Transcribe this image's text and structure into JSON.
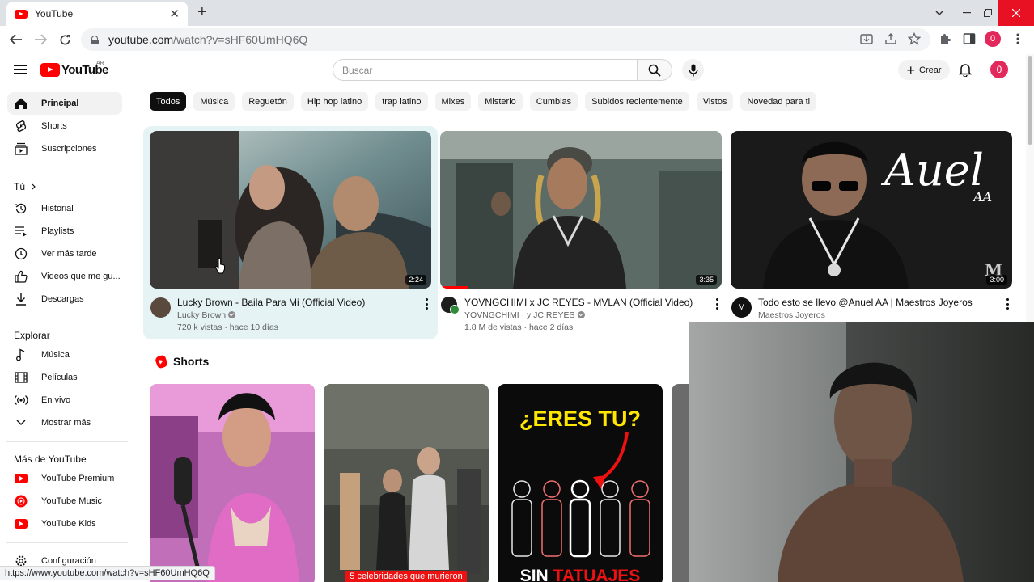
{
  "browser": {
    "tab_title": "YouTube",
    "tab_close": "✕",
    "new_tab": "+",
    "url_host": "youtube.com",
    "url_path": "/watch?v=sHF60UmHQ6Q",
    "profile_initial": "0",
    "status_url": "https://www.youtube.com/watch?v=sHF60UmHQ6Q"
  },
  "header": {
    "logo_text": "YouTube",
    "country_code": "AR",
    "search_placeholder": "Buscar",
    "create_label": "Crear",
    "avatar_initial": "0"
  },
  "sidebar": {
    "main": [
      {
        "label": "Principal",
        "icon": "home-icon",
        "active": true
      },
      {
        "label": "Shorts",
        "icon": "shorts-icon"
      },
      {
        "label": "Suscripciones",
        "icon": "subscriptions-icon"
      }
    ],
    "you_heading": "Tú",
    "you": [
      {
        "label": "Historial",
        "icon": "history-icon"
      },
      {
        "label": "Playlists",
        "icon": "playlists-icon"
      },
      {
        "label": "Ver más tarde",
        "icon": "watch-later-icon"
      },
      {
        "label": "Videos que me gu...",
        "icon": "like-icon"
      },
      {
        "label": "Descargas",
        "icon": "download-icon"
      }
    ],
    "explore_heading": "Explorar",
    "explore": [
      {
        "label": "Música",
        "icon": "music-icon"
      },
      {
        "label": "Películas",
        "icon": "movies-icon"
      },
      {
        "label": "En vivo",
        "icon": "live-icon"
      },
      {
        "label": "Mostrar más",
        "icon": "chevron-down-icon"
      }
    ],
    "more_heading": "Más de YouTube",
    "more": [
      {
        "label": "YouTube Premium",
        "icon": "youtube-premium-icon"
      },
      {
        "label": "YouTube Music",
        "icon": "youtube-music-icon"
      },
      {
        "label": "YouTube Kids",
        "icon": "youtube-kids-icon"
      }
    ],
    "settings_label": "Configuración"
  },
  "chips": [
    "Todos",
    "Música",
    "Reguetón",
    "Hip hop latino",
    "trap latino",
    "Mixes",
    "Misterio",
    "Cumbias",
    "Subidos recientemente",
    "Vistos",
    "Novedad para ti"
  ],
  "videos": [
    {
      "title": "Lucky Brown - Baila Para Mi (Official Video)",
      "channel": "Lucky Brown",
      "stats": "720 k vistas · hace 10 días",
      "duration": "2:24"
    },
    {
      "title": "YOVNGCHIMI x JC REYES - MVLAN (Official Video)",
      "channel": "YOVNGCHIMI · y JC REYES",
      "stats": "1.8 M de vistas · hace 2 días",
      "duration": "3:35"
    },
    {
      "title": "Todo esto se llevo @Anuel AA | Maestros Joyeros",
      "channel": "Maestros Joyeros",
      "stats": "",
      "duration": "3:00",
      "thumb_text": "Auel",
      "thumb_sub": "AA"
    }
  ],
  "shorts": {
    "heading": "Shorts",
    "items": [
      {
        "caption": ""
      },
      {
        "caption": "5 celebridades que murieron"
      },
      {
        "caption": "",
        "top_text": "¿ERES TU?",
        "bottom_text_1": "SIN",
        "bottom_text_2": "TATUAJES"
      }
    ]
  },
  "colors": {
    "brand_red": "#ff0000",
    "avatar_pink": "#e3285b"
  }
}
